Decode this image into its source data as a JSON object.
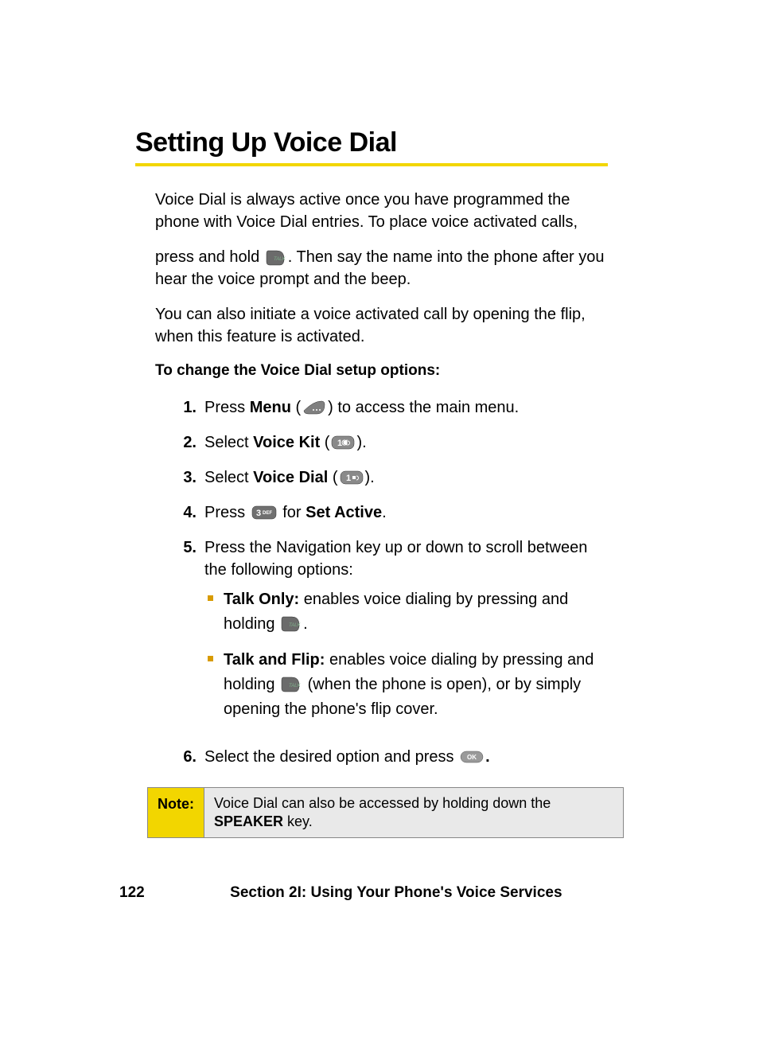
{
  "title": "Setting Up Voice Dial",
  "intro": {
    "p1": "Voice Dial is always active once you have programmed the phone with Voice Dial entries. To place voice activated calls,",
    "p2a": "press and hold ",
    "p2b": ". Then say the name into the phone after you hear the voice prompt and the beep.",
    "p3": "You can also initiate a voice activated call by opening the flip, when this feature is activated."
  },
  "subhead": "To change the Voice Dial setup options:",
  "steps": {
    "s1": {
      "num": "1.",
      "a": "Press ",
      "menu": "Menu",
      "b": " (",
      "c": ") to access the main menu."
    },
    "s2": {
      "num": "2.",
      "a": "Select ",
      "kit": "Voice Kit",
      "b": " (",
      "c": ")."
    },
    "s3": {
      "num": "3.",
      "a": "Select ",
      "vd": "Voice Dial",
      "b": " (",
      "c": ")."
    },
    "s4": {
      "num": "4.",
      "a": "Press ",
      "b": " for ",
      "sa": "Set Active",
      "c": "."
    },
    "s5": {
      "num": "5.",
      "text": "Press the Navigation key up or down to scroll between the following options:"
    },
    "s5sub": {
      "a": {
        "label": "Talk Only:",
        "t1": " enables voice dialing by pressing and holding ",
        "t2": "."
      },
      "b": {
        "label": "Talk and Flip:",
        "t1": " enables voice dialing by pressing and holding ",
        "t2": " (when the phone is open), or by simply opening the phone's flip cover."
      }
    },
    "s6": {
      "num": "6.",
      "a": "Select the desired option and press ",
      "b": "."
    }
  },
  "note": {
    "label": "Note:",
    "a": "Voice Dial can also be accessed by holding down the ",
    "speaker": "SPEAKER",
    "b": " key."
  },
  "footer": {
    "page": "122",
    "section": "Section 2I: Using Your Phone's Voice Services"
  },
  "icons": {
    "talk": "talk-key-icon",
    "menu": "menu-key-icon",
    "one": "one-key-icon",
    "three": "three-def-key-icon",
    "ok": "ok-key-icon"
  }
}
